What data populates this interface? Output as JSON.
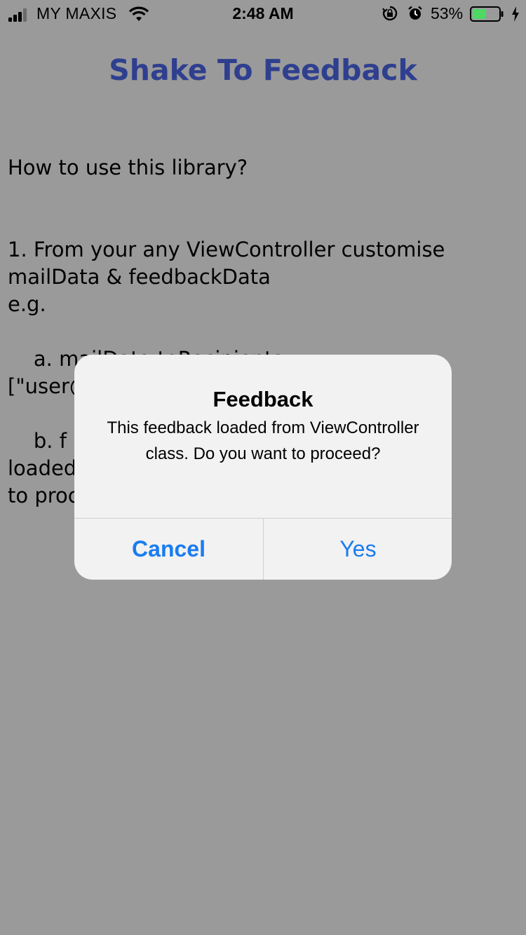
{
  "status_bar": {
    "carrier": "MY MAXIS",
    "time": "2:48 AM",
    "battery_percent": "53%",
    "battery_level": 0.53,
    "signal_bars": 3,
    "signal_total": 4,
    "icons": [
      "signal-icon",
      "wifi-icon",
      "rotation-lock-icon",
      "alarm-icon",
      "battery-icon",
      "charging-bolt-icon"
    ],
    "battery_color": "#4cd964"
  },
  "page": {
    "title": "Shake To Feedback",
    "title_color": "#2f3f8f",
    "body": "How to use this library?\n\n\n1. From your any ViewController customise\nmailData & feedbackData\ne.g.\n\n    a. mailData.toRecipients =\n[\"user@\n\n    b. f                                              back\nloaded                                            want\nto proc"
  },
  "alert": {
    "title": "Feedback",
    "message": "This feedback loaded from ViewController class. Do you want to proceed?",
    "cancel_label": "Cancel",
    "confirm_label": "Yes",
    "button_color": "#1a7cf0"
  }
}
